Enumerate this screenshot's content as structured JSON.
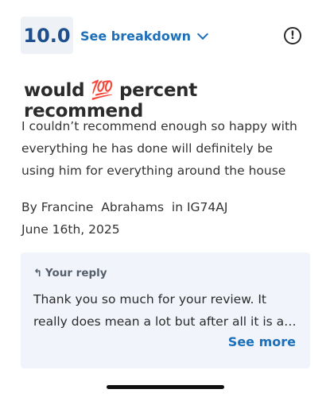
{
  "score": "10.0",
  "breakdown_label": "See breakdown",
  "icons": {
    "breakdown": "chevron-down-icon",
    "info": "info-icon",
    "reply": "reply-arrow-icon"
  },
  "review": {
    "title": "would 💯 percent recommend",
    "body": "I couldn’t recommend enough so happy with everything he has done will definitely be using him for everything around the house",
    "author_line": "By Francine  Abrahams  in IG74AJ",
    "date": "June 16th, 2025"
  },
  "reply": {
    "label": "Your reply",
    "text": "Thank you so much for your review. It really does mean a lot but after all it is a…",
    "see_more": "See more"
  },
  "colors": {
    "accent": "#1d6fb8",
    "score": "#1d4f8c",
    "reply_bg": "#f1f4fa"
  }
}
